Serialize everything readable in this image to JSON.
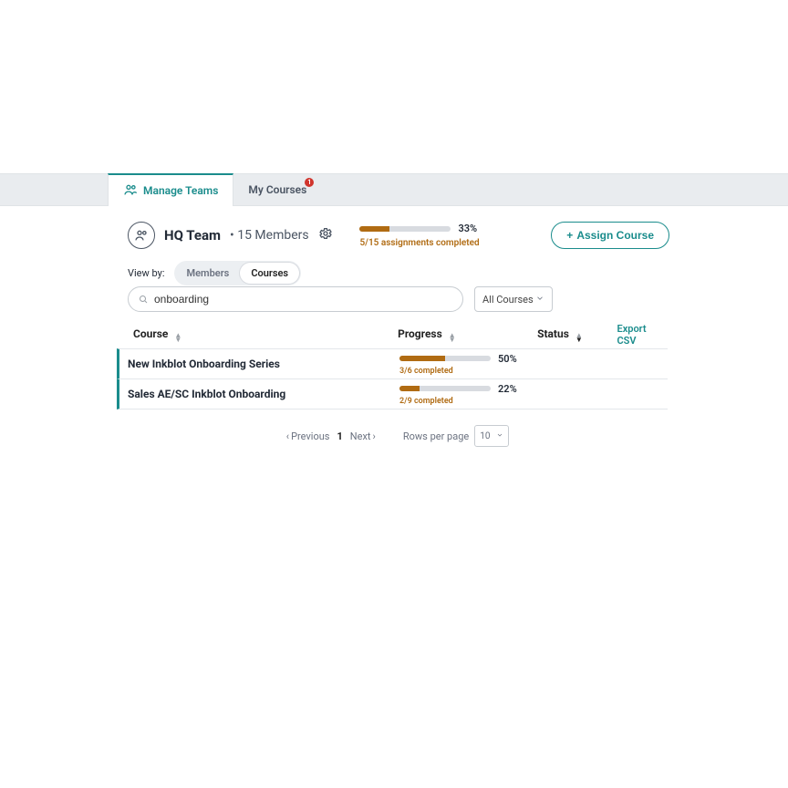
{
  "tabs": {
    "manage_teams": "Manage Teams",
    "my_courses": "My Courses",
    "my_courses_badge": "1"
  },
  "team": {
    "name": "HQ Team",
    "members_label": "• 15 Members"
  },
  "overall_progress": {
    "pct": "33%",
    "pct_fill": "33%",
    "sub": "5/15 assignments completed"
  },
  "assign_btn": "Assign Course",
  "viewby": {
    "label": "View by:",
    "members": "Members",
    "courses": "Courses"
  },
  "search": {
    "value": "onboarding"
  },
  "filter": {
    "selected": "All Courses"
  },
  "columns": {
    "course": "Course",
    "progress": "Progress",
    "status": "Status"
  },
  "export_link": "Export CSV",
  "rows": [
    {
      "course": "New Inkblot Onboarding Series",
      "pct": "50%",
      "fill": "50%",
      "sub": "3/6 completed"
    },
    {
      "course": "Sales AE/SC Inkblot Onboarding",
      "pct": "22%",
      "fill": "22%",
      "sub": "2/9 completed"
    }
  ],
  "pager": {
    "prev": "Previous",
    "next": "Next",
    "current": "1",
    "rpp_label": "Rows per page",
    "rpp_value": "10"
  }
}
